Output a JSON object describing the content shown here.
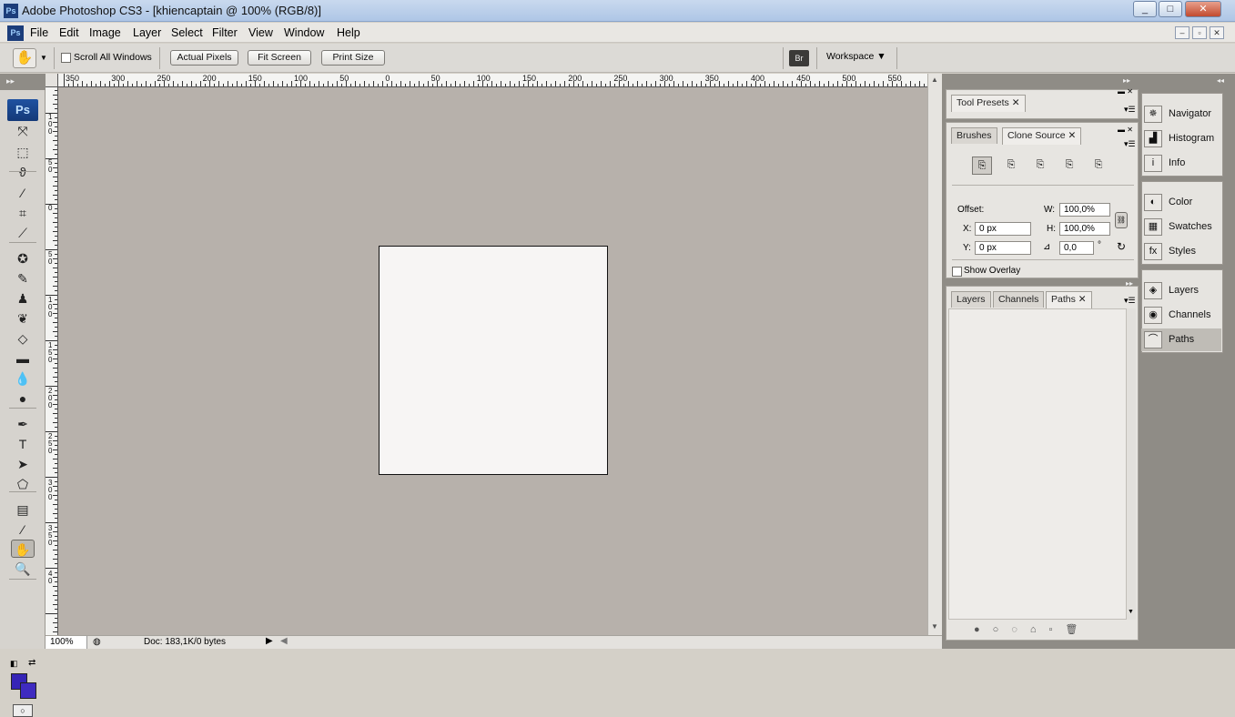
{
  "window": {
    "title": "Adobe Photoshop CS3 - [khiencaptain @ 100% (RGB/8)]",
    "logo_text": "Ps",
    "controls": {
      "minimize": "_",
      "maximize": "□",
      "close": "✕"
    }
  },
  "menu": {
    "items": [
      "File",
      "Edit",
      "Image",
      "Layer",
      "Select",
      "Filter",
      "View",
      "Window",
      "Help"
    ],
    "doc_controls": {
      "minimize": "–",
      "restore": "▫",
      "close": "✕"
    }
  },
  "options": {
    "tool_icon": "hand-icon",
    "scroll_all_windows_label": "Scroll All Windows",
    "scroll_all_windows_checked": false,
    "actual_pixels": "Actual Pixels",
    "fit_screen": "Fit Screen",
    "print_size": "Print Size",
    "workspace": "Workspace ▼",
    "bridge_icon": "Br"
  },
  "toolbox": {
    "badge": "Ps",
    "tools": [
      {
        "name": "move-tool-icon",
        "glyph": "⤧"
      },
      {
        "name": "marquee-tool-icon",
        "glyph": "⬚"
      },
      {
        "name": "lasso-tool-icon",
        "glyph": "ϑ"
      },
      {
        "name": "magic-wand-tool-icon",
        "glyph": "⁄"
      },
      {
        "name": "crop-tool-icon",
        "glyph": "⌗"
      },
      {
        "name": "slice-tool-icon",
        "glyph": "⟋"
      },
      {
        "name": "healing-brush-tool-icon",
        "glyph": "✪"
      },
      {
        "name": "brush-tool-icon",
        "glyph": "✎"
      },
      {
        "name": "clone-stamp-tool-icon",
        "glyph": "♟"
      },
      {
        "name": "history-brush-tool-icon",
        "glyph": "❦"
      },
      {
        "name": "eraser-tool-icon",
        "glyph": "◇"
      },
      {
        "name": "gradient-tool-icon",
        "glyph": "▬"
      },
      {
        "name": "blur-tool-icon",
        "glyph": "💧"
      },
      {
        "name": "dodge-tool-icon",
        "glyph": "●"
      },
      {
        "name": "pen-tool-icon",
        "glyph": "✒"
      },
      {
        "name": "type-tool-icon",
        "glyph": "T"
      },
      {
        "name": "path-selection-tool-icon",
        "glyph": "➤"
      },
      {
        "name": "shape-tool-icon",
        "glyph": "⬠"
      },
      {
        "name": "notes-tool-icon",
        "glyph": "▤"
      },
      {
        "name": "eyedropper-tool-icon",
        "glyph": "⁄"
      },
      {
        "name": "hand-tool-icon",
        "glyph": "✋"
      },
      {
        "name": "zoom-tool-icon",
        "glyph": "🔍"
      }
    ],
    "foreground_color": "#3524b6",
    "background_color": "#3f2bc0"
  },
  "document": {
    "zoom": "100%",
    "doc_info": "Doc: 183,1K/0 bytes",
    "canvas_color": "#f7f5f4",
    "pasteboard_color": "#b7b1ab",
    "hruler_labels": [
      "350",
      "300",
      "250",
      "200",
      "150",
      "100",
      "50",
      "0",
      "50",
      "100",
      "150",
      "200",
      "250",
      "300",
      "350",
      "400",
      "450",
      "500",
      "550"
    ],
    "vruler_labels": [
      "1 0 0",
      "5 0",
      "0",
      "5 0",
      "1 0 0",
      "1 5 0",
      "2 0 0",
      "2 5 0",
      "3 0 0",
      "3 5 0",
      "4 0"
    ]
  },
  "panels": {
    "tool_presets": {
      "tab": "Tool Presets"
    },
    "clone": {
      "tabs": [
        "Brushes",
        "Clone Source"
      ],
      "offset_label": "Offset:",
      "w_label": "W:",
      "w_value": "100,0%",
      "x_label": "X:",
      "x_value": "0 px",
      "h_label": "H:",
      "h_value": "100,0%",
      "y_label": "Y:",
      "y_value": "0 px",
      "angle_value": "0,0",
      "degree": "°",
      "show_overlay": "Show Overlay"
    },
    "layers": {
      "tabs": [
        "Layers",
        "Channels",
        "Paths"
      ]
    },
    "dock": {
      "group1": [
        {
          "label": "Navigator",
          "icon": "navigator-icon",
          "glyph": "✵"
        },
        {
          "label": "Histogram",
          "icon": "histogram-icon",
          "glyph": "▟"
        },
        {
          "label": "Info",
          "icon": "info-icon",
          "glyph": "i"
        }
      ],
      "group2": [
        {
          "label": "Color",
          "icon": "color-icon",
          "glyph": "◐"
        },
        {
          "label": "Swatches",
          "icon": "swatches-icon",
          "glyph": "▦"
        },
        {
          "label": "Styles",
          "icon": "styles-icon",
          "glyph": "fx"
        }
      ],
      "group3": [
        {
          "label": "Layers",
          "icon": "layers-icon",
          "glyph": "◈"
        },
        {
          "label": "Channels",
          "icon": "channels-icon",
          "glyph": "◉"
        },
        {
          "label": "Paths",
          "icon": "paths-icon",
          "glyph": "⌒"
        }
      ]
    }
  }
}
